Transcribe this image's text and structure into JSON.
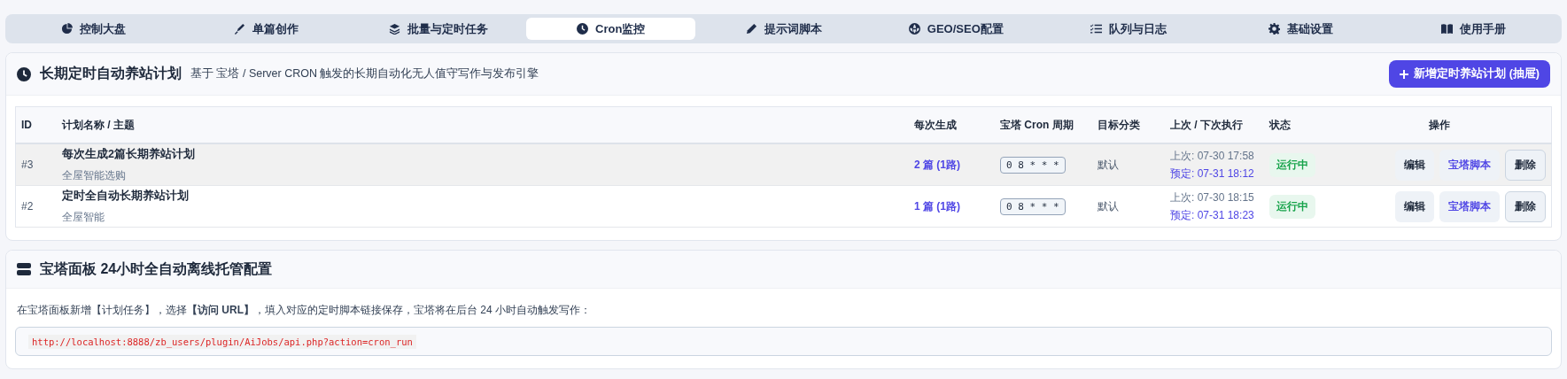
{
  "tabs": [
    {
      "label": "控制大盘",
      "selected": false
    },
    {
      "label": "单篇创作",
      "selected": false
    },
    {
      "label": "批量与定时任务",
      "selected": false
    },
    {
      "label": "Cron监控",
      "selected": true
    },
    {
      "label": "提示词脚本",
      "selected": false
    },
    {
      "label": "GEO/SEO配置",
      "selected": false
    },
    {
      "label": "队列与日志",
      "selected": false
    },
    {
      "label": "基础设置",
      "selected": false
    },
    {
      "label": "使用手册",
      "selected": false
    }
  ],
  "plans_card": {
    "title": "长期定时自动养站计划",
    "subtitle": "基于 宝塔 / Server CRON 触发的长期自动化无人值守写作与发布引擎",
    "add_button": "新增定时养站计划 (抽屉)",
    "table": {
      "columns": [
        "ID",
        "计划名称 / 主题",
        "每次生成",
        "宝塔 Cron 周期",
        "目标分类",
        "上次 / 下次执行",
        "状态",
        "操作"
      ],
      "rows": [
        {
          "id": "#3",
          "name": "每次生成2篇长期养站计划",
          "topic": "全屋智能选购",
          "per_run": "2 篇 (1路)",
          "cron": "0 8 * * *",
          "category": "默认",
          "last": "上次: 07-30 17:58",
          "next": "预定: 07-31 18:12",
          "status": "运行中",
          "actions": [
            "编辑",
            "宝塔脚本",
            "删除"
          ],
          "selected": true
        },
        {
          "id": "#2",
          "name": "定时全自动长期养站计划",
          "topic": "全屋智能",
          "per_run": "1 篇 (1路)",
          "cron": "0 8 * * *",
          "category": "默认",
          "last": "上次: 07-30 18:15",
          "next": "预定: 07-31 18:23",
          "status": "运行中",
          "actions": [
            "编辑",
            "宝塔脚本",
            "删除"
          ],
          "selected": false
        }
      ]
    }
  },
  "bt_card": {
    "title": "宝塔面板 24小时全自动离线托管配置",
    "instruction": "在宝塔面板新增【计划任务】，选择**【访问 URL】**，填入对应的定时脚本链接保存，宝塔将在后台 24 小时自动触发写作：",
    "url": "http://localhost:8888/zb_users/plugin/AiJobs/api.php?action=cron_run"
  }
}
